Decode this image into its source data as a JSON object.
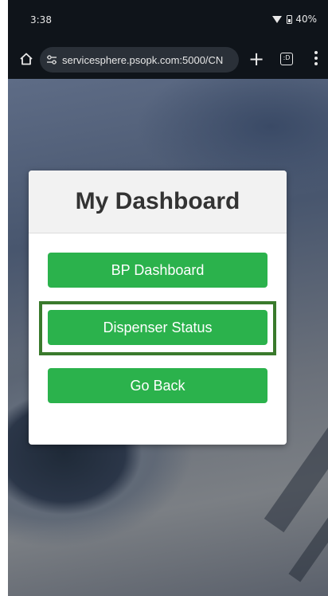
{
  "status_bar": {
    "time": "3:38",
    "battery": "40%"
  },
  "browser": {
    "url": "servicesphere.psopk.com:5000/CN",
    "icons": [
      "home-icon",
      "site-settings-icon",
      "new-tab-icon",
      "tab-switcher-icon",
      "menu-icon"
    ],
    "tab_count_glyph": ":D"
  },
  "dashboard": {
    "title": "My Dashboard",
    "buttons": [
      {
        "label": "BP Dashboard"
      },
      {
        "label": "Dispenser Status"
      },
      {
        "label": "Go Back"
      }
    ],
    "highlighted_button": "Dispenser Status",
    "colors": {
      "button_green": "#2bb24c",
      "highlight_border": "#3a7a2c",
      "header_bg": "#f2f2f2"
    }
  }
}
